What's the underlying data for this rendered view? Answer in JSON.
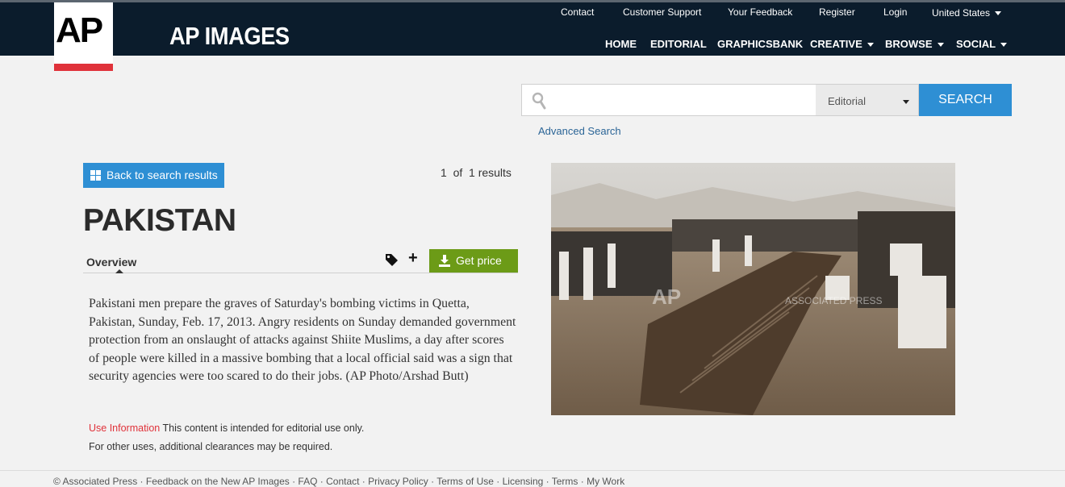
{
  "header": {
    "logo_text": "AP",
    "brand": "AP IMAGES",
    "util_links": [
      "Contact",
      "Customer Support",
      "Your Feedback",
      "Register",
      "Login"
    ],
    "country": "United States",
    "nav": [
      "HOME",
      "EDITORIAL",
      "GRAPHICSBANK",
      "CREATIVE",
      "BROWSE",
      "SOCIAL"
    ]
  },
  "search": {
    "placeholder": "",
    "category": "Editorial",
    "button": "SEARCH",
    "advanced": "Advanced Search"
  },
  "detail": {
    "back_label": "Back to search results",
    "results_text": "1  of  1 results",
    "title": "PAKISTAN",
    "tab_overview": "Overview",
    "price_label": "Get price",
    "caption": "Pakistani men prepare the graves of Saturday's bombing victims in Quetta, Pakistan, Sunday, Feb. 17, 2013. Angry residents on Sunday demanded government protection from an onslaught of attacks against Shiite Muslims, a day after scores of people were killed in a massive bombing that a local official said was a sign that security agencies were too scared to do their jobs. (AP Photo/Arshad Butt)",
    "use_info_label": "Use Information",
    "use_info_text": " This content is intended for editorial use only.",
    "use_info_text2": "For other uses, additional clearances may be required.",
    "watermark": "ASSOCIATED PRESS"
  },
  "footer": {
    "text": "© Associated Press · Feedback on the New AP Images · FAQ · Contact · Privacy Policy · Terms of Use · Licensing · Terms · My Work"
  },
  "colors": {
    "header_bg": "#0b1c2c",
    "accent_blue": "#2e8fd4",
    "price_green": "#6c9b17",
    "logo_red": "#e0323a"
  }
}
